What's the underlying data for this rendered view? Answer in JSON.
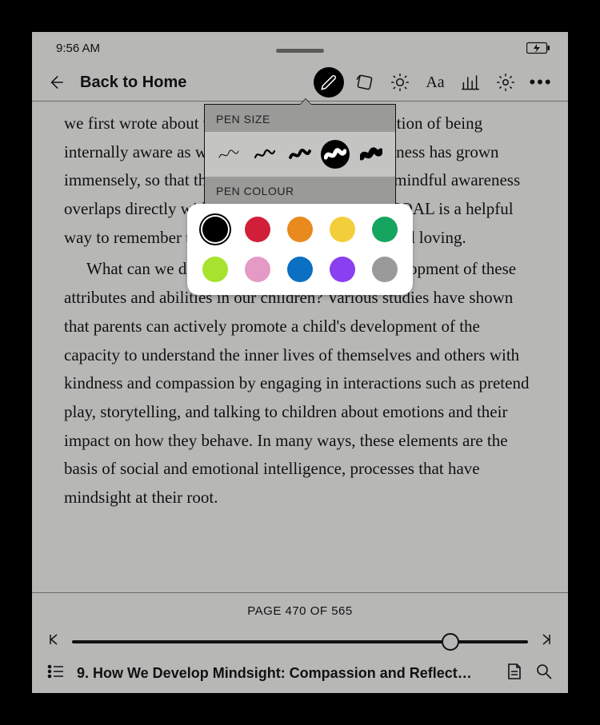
{
  "status": {
    "time": "9:56 AM"
  },
  "header": {
    "back_label": "Back to Home"
  },
  "popover": {
    "size_label": "PEN SIZE",
    "colour_label": "PEN COLOUR",
    "selected_size_index": 3,
    "selected_colour_index": 0,
    "colours": [
      "#000000",
      "#d11f3a",
      "#e98a1f",
      "#f2cf3a",
      "#15a55f",
      "#a6e22e",
      "#e59ac6",
      "#0b6fc2",
      "#8a3ff0",
      "#9a9a9a"
    ]
  },
  "body": {
    "para1": "we first wrote about this approach, the general notion of being internally aware as well as the science of mindfulness has grown immensely, so that the presence and openness of mindful awareness overlaps directly with these ideas. The acronym COAL is a helpful way to remember this: curious, open, accepting, and loving.",
    "para2": "What can we do as parents to promote the development of these attributes and abilities in our children? Various studies have shown that parents can actively promote a child's development of the capacity to understand the inner lives of themselves and others with kindness and compassion by engaging in interactions such as pretend play, storytelling, and talking to children about emotions and their impact on how they behave. In many ways, these elements are the basis of social and emotional intelligence, processes that have mindsight at their root."
  },
  "footer": {
    "page_label": "PAGE 470 OF 565",
    "progress_pct": 83,
    "chapter_title": "9. How We Develop Mindsight: Compassion and Reflect…"
  }
}
